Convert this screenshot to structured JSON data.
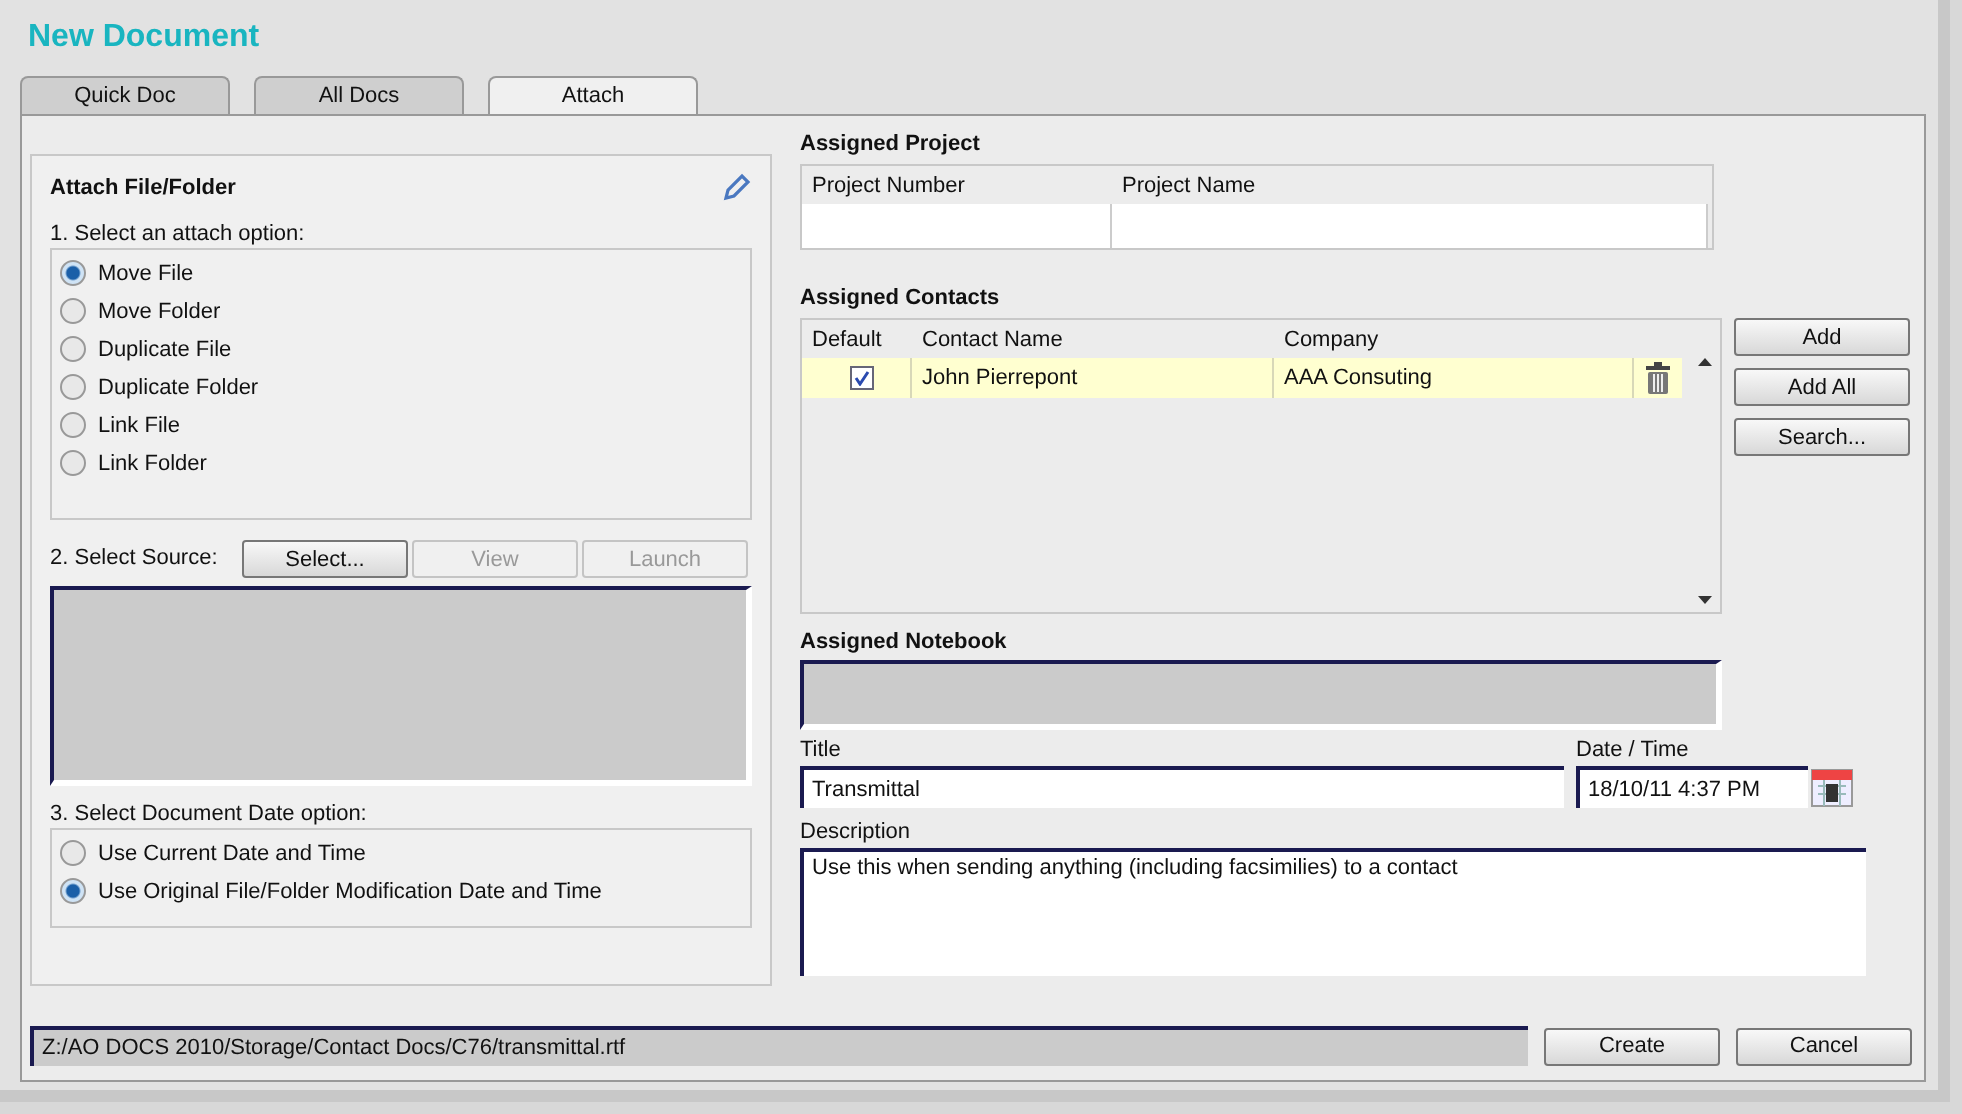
{
  "window": {
    "title": "New Document"
  },
  "tabs": [
    {
      "label": "Quick Doc",
      "selected": false
    },
    {
      "label": "All Docs",
      "selected": false
    },
    {
      "label": "Attach",
      "selected": true
    }
  ],
  "attach": {
    "title": "Attach File/Folder",
    "step1": "1. Select an attach option:",
    "options": [
      {
        "label": "Move File",
        "selected": true
      },
      {
        "label": "Move Folder",
        "selected": false
      },
      {
        "label": "Duplicate File",
        "selected": false
      },
      {
        "label": "Duplicate Folder",
        "selected": false
      },
      {
        "label": "Link File",
        "selected": false
      },
      {
        "label": "Link Folder",
        "selected": false
      }
    ],
    "step2": "2. Select Source:",
    "source_buttons": [
      {
        "label": "Select...",
        "disabled": false
      },
      {
        "label": "View",
        "disabled": true
      },
      {
        "label": "Launch",
        "disabled": true
      }
    ],
    "step3": "3. Select Document Date option:",
    "date_options": [
      {
        "label": "Use Current Date and Time",
        "selected": false
      },
      {
        "label": "Use Original File/Folder Modification Date and Time",
        "selected": true
      }
    ]
  },
  "project": {
    "title": "Assigned Project",
    "columns": [
      "Project Number",
      "Project Name"
    ]
  },
  "contacts": {
    "title": "Assigned Contacts",
    "columns": [
      "Default",
      "Contact Name",
      "Company"
    ],
    "rows": [
      {
        "default": true,
        "name": "John Pierrepont",
        "company": "AAA Consuting",
        "selected": true
      }
    ],
    "buttons": [
      "Add",
      "Add All",
      "Search..."
    ]
  },
  "notebook": {
    "title": "Assigned Notebook"
  },
  "title_field": {
    "label": "Title",
    "value": "Transmittal"
  },
  "date_field": {
    "label": "Date / Time",
    "value": "18/10/11 4:37 PM"
  },
  "description": {
    "label": "Description",
    "value": "Use this when sending anything (including facsimilies) to a contact"
  },
  "path": "Z:/AO DOCS 2010/Storage/Contact Docs/C76/transmittal.rtf",
  "footer_buttons": [
    "Create",
    "Cancel"
  ]
}
